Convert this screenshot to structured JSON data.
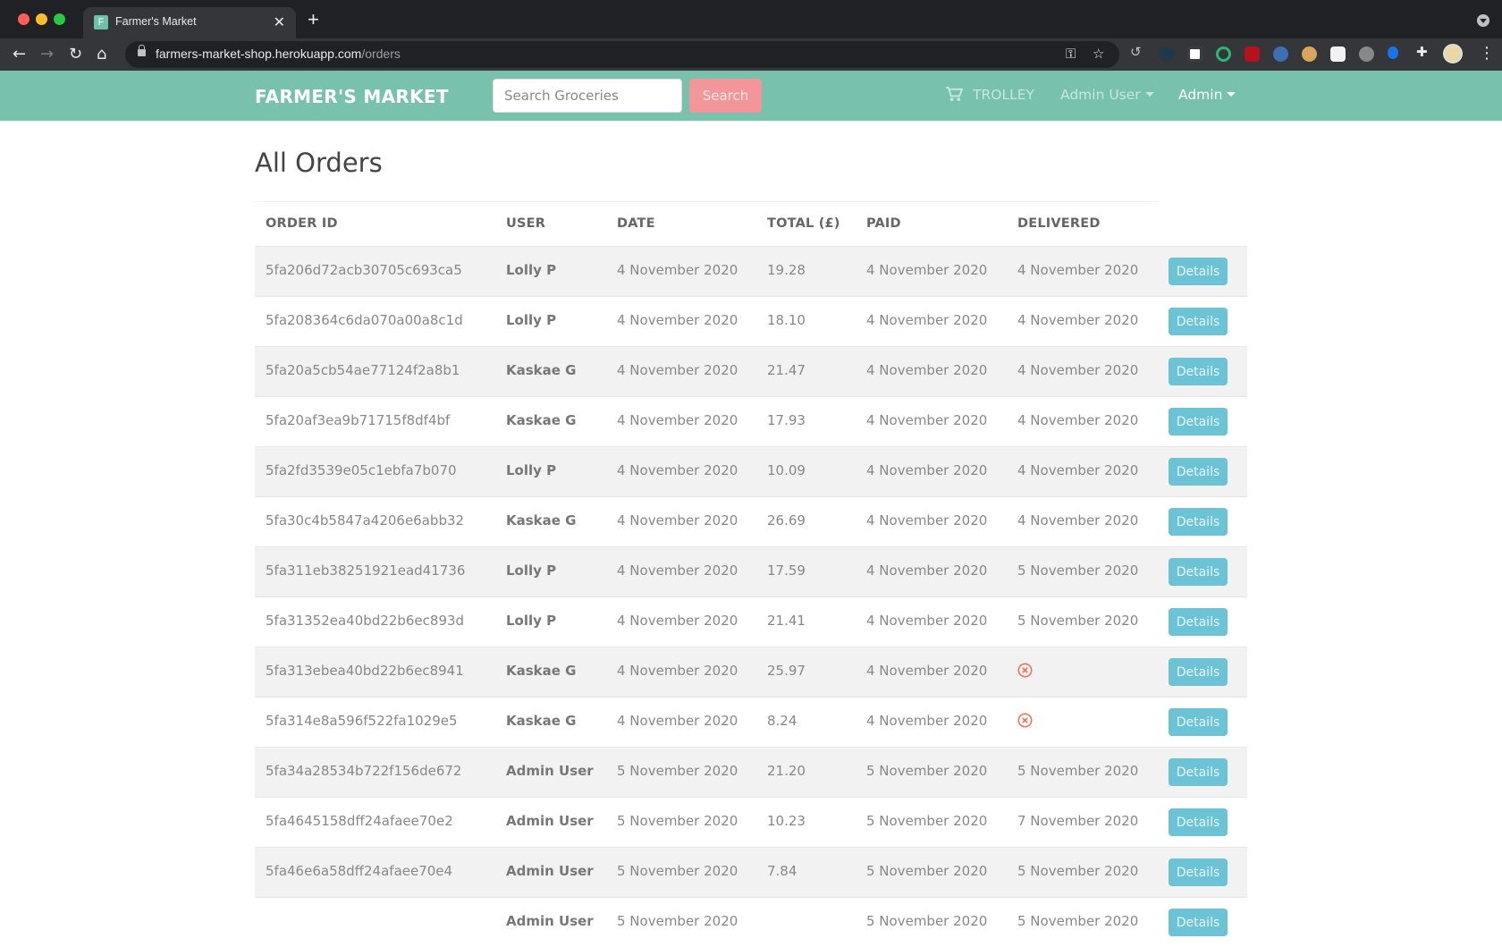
{
  "browser": {
    "tab_title": "Farmer's Market",
    "tab_favicon_letter": "F",
    "url_host": "farmers-market-shop.herokuapp.com",
    "url_path": "/orders"
  },
  "navbar": {
    "brand": "FARMER'S MARKET",
    "search_placeholder": "Search Groceries",
    "search_button": "Search",
    "trolley": "TROLLEY",
    "user_menu": "Admin User",
    "admin_menu": "Admin"
  },
  "page": {
    "title": "All Orders"
  },
  "table": {
    "headers": {
      "order_id": "ORDER ID",
      "user": "USER",
      "date": "DATE",
      "total": "TOTAL (£)",
      "paid": "PAID",
      "delivered": "DELIVERED"
    },
    "details_label": "Details",
    "not_delivered_icon": "times-circle-icon",
    "colors": {
      "not_delivered": "#e9765b",
      "details_button": "#6cc3d5",
      "brand": "#78c2ad",
      "search_button": "#f3969a"
    },
    "rows": [
      {
        "id": "5fa206d72acb30705c693ca5",
        "user": "Lolly P",
        "date": "4 November 2020",
        "total": "19.28",
        "paid": "4 November 2020",
        "delivered": "4 November 2020"
      },
      {
        "id": "5fa208364c6da070a00a8c1d",
        "user": "Lolly P",
        "date": "4 November 2020",
        "total": "18.10",
        "paid": "4 November 2020",
        "delivered": "4 November 2020"
      },
      {
        "id": "5fa20a5cb54ae77124f2a8b1",
        "user": "Kaskae G",
        "date": "4 November 2020",
        "total": "21.47",
        "paid": "4 November 2020",
        "delivered": "4 November 2020"
      },
      {
        "id": "5fa20af3ea9b71715f8df4bf",
        "user": "Kaskae G",
        "date": "4 November 2020",
        "total": "17.93",
        "paid": "4 November 2020",
        "delivered": "4 November 2020"
      },
      {
        "id": "5fa2fd3539e05c1ebfa7b070",
        "user": "Lolly P",
        "date": "4 November 2020",
        "total": "10.09",
        "paid": "4 November 2020",
        "delivered": "4 November 2020"
      },
      {
        "id": "5fa30c4b5847a4206e6abb32",
        "user": "Kaskae G",
        "date": "4 November 2020",
        "total": "26.69",
        "paid": "4 November 2020",
        "delivered": "4 November 2020"
      },
      {
        "id": "5fa311eb38251921ead41736",
        "user": "Lolly P",
        "date": "4 November 2020",
        "total": "17.59",
        "paid": "4 November 2020",
        "delivered": "5 November 2020"
      },
      {
        "id": "5fa31352ea40bd22b6ec893d",
        "user": "Lolly P",
        "date": "4 November 2020",
        "total": "21.41",
        "paid": "4 November 2020",
        "delivered": "5 November 2020"
      },
      {
        "id": "5fa313ebea40bd22b6ec8941",
        "user": "Kaskae G",
        "date": "4 November 2020",
        "total": "25.97",
        "paid": "4 November 2020",
        "delivered": null
      },
      {
        "id": "5fa314e8a596f522fa1029e5",
        "user": "Kaskae G",
        "date": "4 November 2020",
        "total": "8.24",
        "paid": "4 November 2020",
        "delivered": null
      },
      {
        "id": "5fa34a28534b722f156de672",
        "user": "Admin User",
        "date": "5 November 2020",
        "total": "21.20",
        "paid": "5 November 2020",
        "delivered": "5 November 2020"
      },
      {
        "id": "5fa4645158dff24afaee70e2",
        "user": "Admin User",
        "date": "5 November 2020",
        "total": "10.23",
        "paid": "5 November 2020",
        "delivered": "7 November 2020"
      },
      {
        "id": "5fa46e6a58dff24afaee70e4",
        "user": "Admin User",
        "date": "5 November 2020",
        "total": "7.84",
        "paid": "5 November 2020",
        "delivered": "5 November 2020"
      },
      {
        "id": "",
        "user": "Admin User",
        "date": "5 November 2020",
        "total": "",
        "paid": "5 November 2020",
        "delivered": "5 November 2020"
      }
    ]
  }
}
